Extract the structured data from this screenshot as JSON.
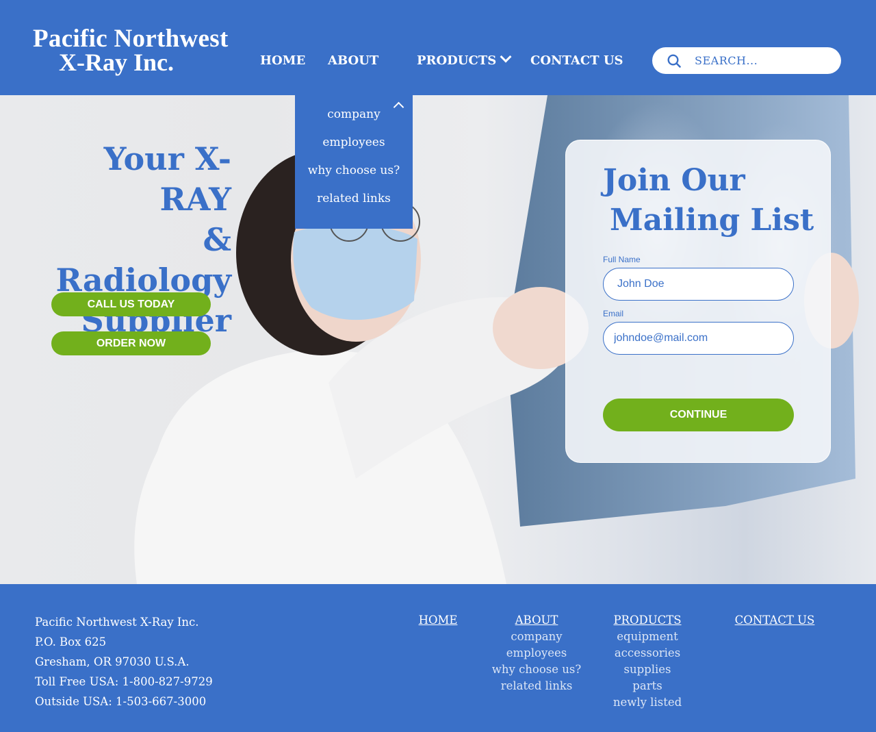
{
  "brand": {
    "logo_line1": "Pacific Northwest",
    "logo_line2": "X-Ray Inc."
  },
  "nav": {
    "home": "HOME",
    "about": "ABOUT",
    "products": "PRODUCTS",
    "contact": "CONTACT US"
  },
  "search": {
    "placeholder": "SEARCH..."
  },
  "about_dropdown": {
    "items": [
      "company",
      "employees",
      "why choose us?",
      "related links"
    ]
  },
  "hero": {
    "title_line1": "Your X-RAY",
    "title_line2": "& Radiology",
    "title_line3": "Supplier",
    "call_button": "CALL US TODAY",
    "order_button": "ORDER NOW"
  },
  "mailing": {
    "title_line1": "Join Our",
    "title_line2": "Mailing List",
    "name_label": "Full Name",
    "name_value": "John Doe",
    "email_label": "Email",
    "email_value": "johndoe@mail.com",
    "continue_button": "CONTINUE"
  },
  "footer": {
    "address": {
      "company": "Pacific Northwest X-Ray Inc.",
      "po_box": "P.O. Box 625",
      "city": "Gresham, OR 97030 U.S.A.",
      "toll_free": "Toll Free USA: 1-800-827-9729",
      "outside": "Outside USA: 1-503-667-3000"
    },
    "home": "HOME",
    "about": {
      "heading": "ABOUT",
      "links": [
        "company",
        "employees",
        "why choose us?",
        "related links"
      ]
    },
    "products": {
      "heading": "PRODUCTS",
      "links": [
        "equipment",
        "accessories",
        "supplies",
        "parts",
        "newly listed"
      ]
    },
    "contact": "CONTACT US"
  },
  "colors": {
    "brand_blue": "#3a70c8",
    "accent_green": "#72b01c"
  }
}
